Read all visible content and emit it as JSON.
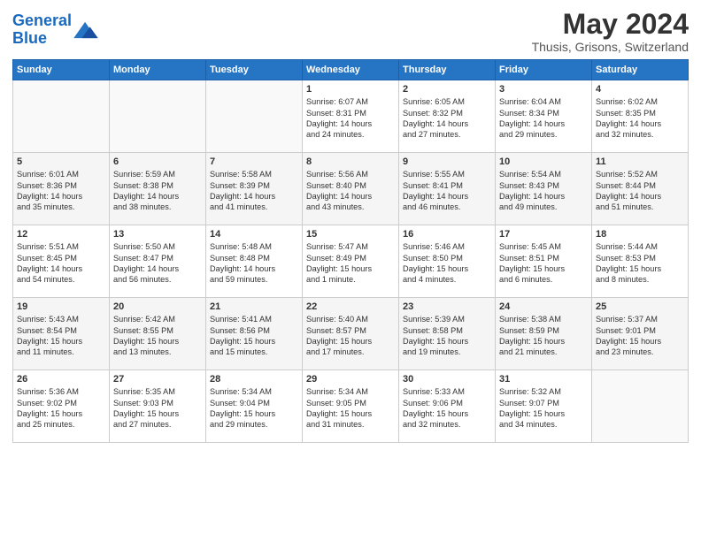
{
  "logo": {
    "line1": "General",
    "line2": "Blue"
  },
  "title": "May 2024",
  "subtitle": "Thusis, Grisons, Switzerland",
  "days_of_week": [
    "Sunday",
    "Monday",
    "Tuesday",
    "Wednesday",
    "Thursday",
    "Friday",
    "Saturday"
  ],
  "weeks": [
    [
      {
        "day": "",
        "text": ""
      },
      {
        "day": "",
        "text": ""
      },
      {
        "day": "",
        "text": ""
      },
      {
        "day": "1",
        "text": "Sunrise: 6:07 AM\nSunset: 8:31 PM\nDaylight: 14 hours\nand 24 minutes."
      },
      {
        "day": "2",
        "text": "Sunrise: 6:05 AM\nSunset: 8:32 PM\nDaylight: 14 hours\nand 27 minutes."
      },
      {
        "day": "3",
        "text": "Sunrise: 6:04 AM\nSunset: 8:34 PM\nDaylight: 14 hours\nand 29 minutes."
      },
      {
        "day": "4",
        "text": "Sunrise: 6:02 AM\nSunset: 8:35 PM\nDaylight: 14 hours\nand 32 minutes."
      }
    ],
    [
      {
        "day": "5",
        "text": "Sunrise: 6:01 AM\nSunset: 8:36 PM\nDaylight: 14 hours\nand 35 minutes."
      },
      {
        "day": "6",
        "text": "Sunrise: 5:59 AM\nSunset: 8:38 PM\nDaylight: 14 hours\nand 38 minutes."
      },
      {
        "day": "7",
        "text": "Sunrise: 5:58 AM\nSunset: 8:39 PM\nDaylight: 14 hours\nand 41 minutes."
      },
      {
        "day": "8",
        "text": "Sunrise: 5:56 AM\nSunset: 8:40 PM\nDaylight: 14 hours\nand 43 minutes."
      },
      {
        "day": "9",
        "text": "Sunrise: 5:55 AM\nSunset: 8:41 PM\nDaylight: 14 hours\nand 46 minutes."
      },
      {
        "day": "10",
        "text": "Sunrise: 5:54 AM\nSunset: 8:43 PM\nDaylight: 14 hours\nand 49 minutes."
      },
      {
        "day": "11",
        "text": "Sunrise: 5:52 AM\nSunset: 8:44 PM\nDaylight: 14 hours\nand 51 minutes."
      }
    ],
    [
      {
        "day": "12",
        "text": "Sunrise: 5:51 AM\nSunset: 8:45 PM\nDaylight: 14 hours\nand 54 minutes."
      },
      {
        "day": "13",
        "text": "Sunrise: 5:50 AM\nSunset: 8:47 PM\nDaylight: 14 hours\nand 56 minutes."
      },
      {
        "day": "14",
        "text": "Sunrise: 5:48 AM\nSunset: 8:48 PM\nDaylight: 14 hours\nand 59 minutes."
      },
      {
        "day": "15",
        "text": "Sunrise: 5:47 AM\nSunset: 8:49 PM\nDaylight: 15 hours\nand 1 minute."
      },
      {
        "day": "16",
        "text": "Sunrise: 5:46 AM\nSunset: 8:50 PM\nDaylight: 15 hours\nand 4 minutes."
      },
      {
        "day": "17",
        "text": "Sunrise: 5:45 AM\nSunset: 8:51 PM\nDaylight: 15 hours\nand 6 minutes."
      },
      {
        "day": "18",
        "text": "Sunrise: 5:44 AM\nSunset: 8:53 PM\nDaylight: 15 hours\nand 8 minutes."
      }
    ],
    [
      {
        "day": "19",
        "text": "Sunrise: 5:43 AM\nSunset: 8:54 PM\nDaylight: 15 hours\nand 11 minutes."
      },
      {
        "day": "20",
        "text": "Sunrise: 5:42 AM\nSunset: 8:55 PM\nDaylight: 15 hours\nand 13 minutes."
      },
      {
        "day": "21",
        "text": "Sunrise: 5:41 AM\nSunset: 8:56 PM\nDaylight: 15 hours\nand 15 minutes."
      },
      {
        "day": "22",
        "text": "Sunrise: 5:40 AM\nSunset: 8:57 PM\nDaylight: 15 hours\nand 17 minutes."
      },
      {
        "day": "23",
        "text": "Sunrise: 5:39 AM\nSunset: 8:58 PM\nDaylight: 15 hours\nand 19 minutes."
      },
      {
        "day": "24",
        "text": "Sunrise: 5:38 AM\nSunset: 8:59 PM\nDaylight: 15 hours\nand 21 minutes."
      },
      {
        "day": "25",
        "text": "Sunrise: 5:37 AM\nSunset: 9:01 PM\nDaylight: 15 hours\nand 23 minutes."
      }
    ],
    [
      {
        "day": "26",
        "text": "Sunrise: 5:36 AM\nSunset: 9:02 PM\nDaylight: 15 hours\nand 25 minutes."
      },
      {
        "day": "27",
        "text": "Sunrise: 5:35 AM\nSunset: 9:03 PM\nDaylight: 15 hours\nand 27 minutes."
      },
      {
        "day": "28",
        "text": "Sunrise: 5:34 AM\nSunset: 9:04 PM\nDaylight: 15 hours\nand 29 minutes."
      },
      {
        "day": "29",
        "text": "Sunrise: 5:34 AM\nSunset: 9:05 PM\nDaylight: 15 hours\nand 31 minutes."
      },
      {
        "day": "30",
        "text": "Sunrise: 5:33 AM\nSunset: 9:06 PM\nDaylight: 15 hours\nand 32 minutes."
      },
      {
        "day": "31",
        "text": "Sunrise: 5:32 AM\nSunset: 9:07 PM\nDaylight: 15 hours\nand 34 minutes."
      },
      {
        "day": "",
        "text": ""
      }
    ]
  ]
}
